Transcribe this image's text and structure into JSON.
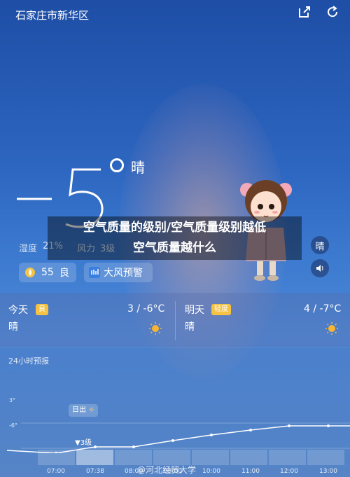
{
  "location": {
    "city": "石家庄市新华区"
  },
  "current": {
    "condition": "晴"
  },
  "banner": {
    "line1": "空气质量的级别/空气质量级别越低",
    "line2": "空气质量越什么"
  },
  "meta": {
    "humidity_label": "湿度",
    "humidity_value": "21%",
    "wind_label": "风力",
    "wind_value": "3级"
  },
  "aqi": {
    "value": "55",
    "level": "良"
  },
  "alert": {
    "label": "大风预警"
  },
  "side_buttons": {
    "clear_label": "晴"
  },
  "forecast": {
    "today": {
      "label": "今天",
      "tag": "良",
      "range": "3 / -6°C",
      "condition": "晴"
    },
    "tomorrow": {
      "label": "明天",
      "tag": "轻度",
      "range": "4 / -7°C",
      "condition": "晴"
    }
  },
  "hourly": {
    "title": "24小时预报",
    "axis_top": "3°",
    "axis_bottom": "-6°",
    "sunrise_label": "日出",
    "wind_label": "3级",
    "times": [
      "07:00",
      "07:38",
      "08:00",
      "09:00",
      "10:00",
      "11:00",
      "12:00",
      "13:00"
    ]
  },
  "watermark": "@河北经贸大学",
  "icons": {
    "share": "share-icon",
    "refresh": "refresh-icon",
    "aqi": "leaf-icon",
    "alert": "alert-icon",
    "speaker": "speaker-icon",
    "sun": "sun-icon"
  },
  "colors": {
    "tag_yellow": "#f5c244",
    "sun_orange": "#f7b531",
    "curve": "#ffffff"
  }
}
